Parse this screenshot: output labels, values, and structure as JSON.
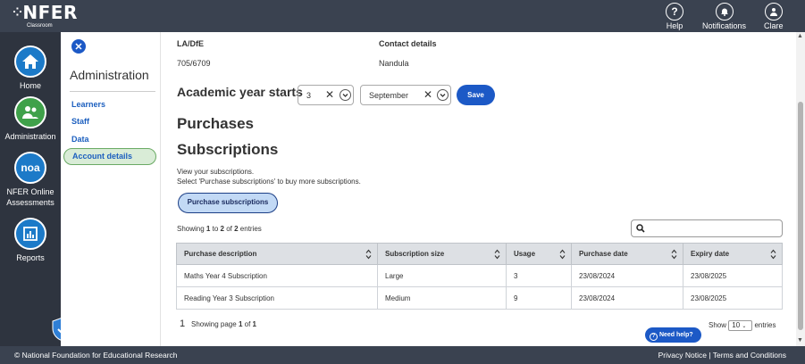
{
  "brand": {
    "logo": "NFER",
    "logo_sub": "Classroom"
  },
  "topnav": [
    {
      "label": "Help",
      "icon": "help-icon",
      "glyph": "?"
    },
    {
      "label": "Notifications",
      "icon": "bell-icon"
    },
    {
      "label": "Clare",
      "icon": "user-icon"
    }
  ],
  "sidebar": {
    "items": [
      {
        "label": "Home",
        "icon": "home-icon",
        "color": "#1c7ac8"
      },
      {
        "label": "Administration",
        "icon": "people-icon",
        "color": "#3fa14a"
      },
      {
        "label": "NFER Online Assessments",
        "icon": "noa-icon",
        "glyph": "noa",
        "color": "#1c7ac8"
      },
      {
        "label": "Reports",
        "icon": "reports-icon",
        "color": "#1c7ac8"
      }
    ]
  },
  "admin_panel": {
    "title": "Administration",
    "links": [
      "Learners",
      "Staff",
      "Data"
    ],
    "active": "Account details"
  },
  "school": {
    "la_label": "LA/DfE",
    "la_value": "705/6709",
    "contact_label": "Contact details",
    "contact_value": "Nandula"
  },
  "academic": {
    "label": "Academic year starts",
    "day": "3",
    "month": "September",
    "save_label": "Save"
  },
  "purchases": {
    "heading": "Purchases",
    "subheading": "Subscriptions",
    "intro_line1": "View your subscriptions.",
    "intro_line2": "Select 'Purchase subscriptions' to buy more subscriptions.",
    "purchase_button": "Purchase subscriptions",
    "showing_prefix": "Showing",
    "showing_from": "1",
    "showing_to_word": "to",
    "showing_to": "2",
    "showing_of": "of",
    "showing_total": "2",
    "showing_suffix": "entries"
  },
  "table": {
    "headers": [
      "Purchase description",
      "Subscription size",
      "Usage",
      "Purchase date",
      "Expiry date"
    ],
    "rows": [
      [
        "Maths Year 4 Subscription",
        "Large",
        "3",
        "23/08/2024",
        "23/08/2025"
      ],
      [
        "Reading Year 3 Subscription",
        "Medium",
        "9",
        "23/08/2024",
        "23/08/2025"
      ]
    ]
  },
  "pagination": {
    "current": "1",
    "info_prefix": "Showing page",
    "page": "1",
    "of": "of",
    "total": "1",
    "show_label": "Show",
    "show_value": "10",
    "entries_label": "entries"
  },
  "help": {
    "label": "Need help?"
  },
  "footer": {
    "copyright": "© National Foundation for Educational Research",
    "privacy": "Privacy Notice",
    "separator": "|",
    "terms": "Terms and Conditions"
  },
  "colors": {
    "accent": "#1c59c6",
    "topbar": "#3a4250",
    "sidebar": "#2e343f",
    "active_bg": "#d9ecd7"
  }
}
